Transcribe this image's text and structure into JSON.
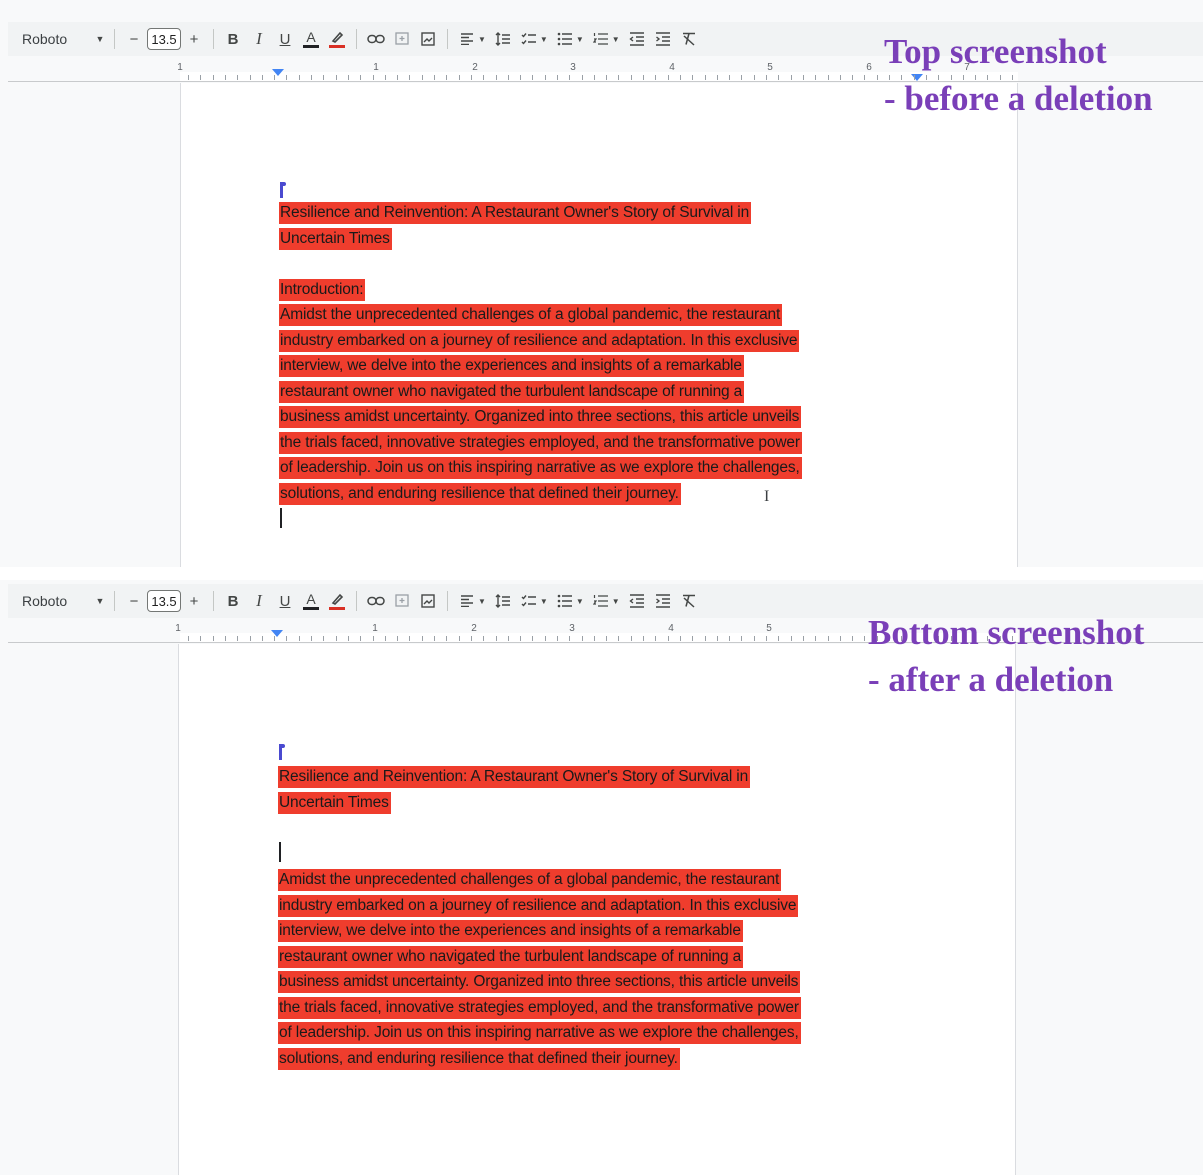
{
  "toolbar": {
    "font": "Roboto",
    "decrease_size": "−",
    "font_size": "13.5",
    "increase_size": "+",
    "bold": "B",
    "italic": "I",
    "underline": "U",
    "text_color": "A",
    "text_color_hex": "#202124",
    "highlight_color_hex": "#d93025"
  },
  "ruler": {
    "numbers": [
      "1",
      "1",
      "2",
      "3",
      "4",
      "5",
      "6",
      "7"
    ]
  },
  "top": {
    "caption_line1": "Top screenshot",
    "caption_line2": "- before a deletion",
    "title_lines": [
      "Resilience and Reinvention: A Restaurant Owner's Story of Survival in",
      "Uncertain Times"
    ],
    "heading": "Introduction:",
    "body_lines": [
      "Amidst the unprecedented challenges of a global pandemic, the restaurant",
      "industry embarked on a journey of resilience and adaptation. In this exclusive",
      "interview, we delve into the experiences and insights of a remarkable",
      "restaurant owner who navigated the turbulent landscape of running a",
      "business amidst uncertainty. Organized into three sections, this article unveils",
      "the trials faced, innovative strategies employed, and the transformative power",
      "of leadership. Join us on this inspiring narrative as we explore the challenges,",
      "solutions, and enduring resilience that defined their journey."
    ]
  },
  "bottom": {
    "caption_line1": "Bottom screenshot",
    "caption_line2": "- after a deletion",
    "title_lines": [
      "Resilience and Reinvention: A Restaurant Owner's Story of Survival in",
      "Uncertain Times"
    ],
    "body_lines": [
      "Amidst the unprecedented challenges of a global pandemic, the restaurant",
      "industry embarked on a journey of resilience and adaptation. In this exclusive",
      "interview, we delve into the experiences and insights of a remarkable",
      "restaurant owner who navigated the turbulent landscape of running a",
      "business amidst uncertainty. Organized into three sections, this article unveils",
      "the trials faced, innovative strategies employed, and the transformative power",
      "of leadership. Join us on this inspiring narrative as we explore the challenges,",
      "solutions, and enduring resilience that defined their journey."
    ]
  },
  "colors": {
    "highlight": "#ef3d2d",
    "caption": "#7a3fb8",
    "ruler_marker": "#4285f4"
  }
}
